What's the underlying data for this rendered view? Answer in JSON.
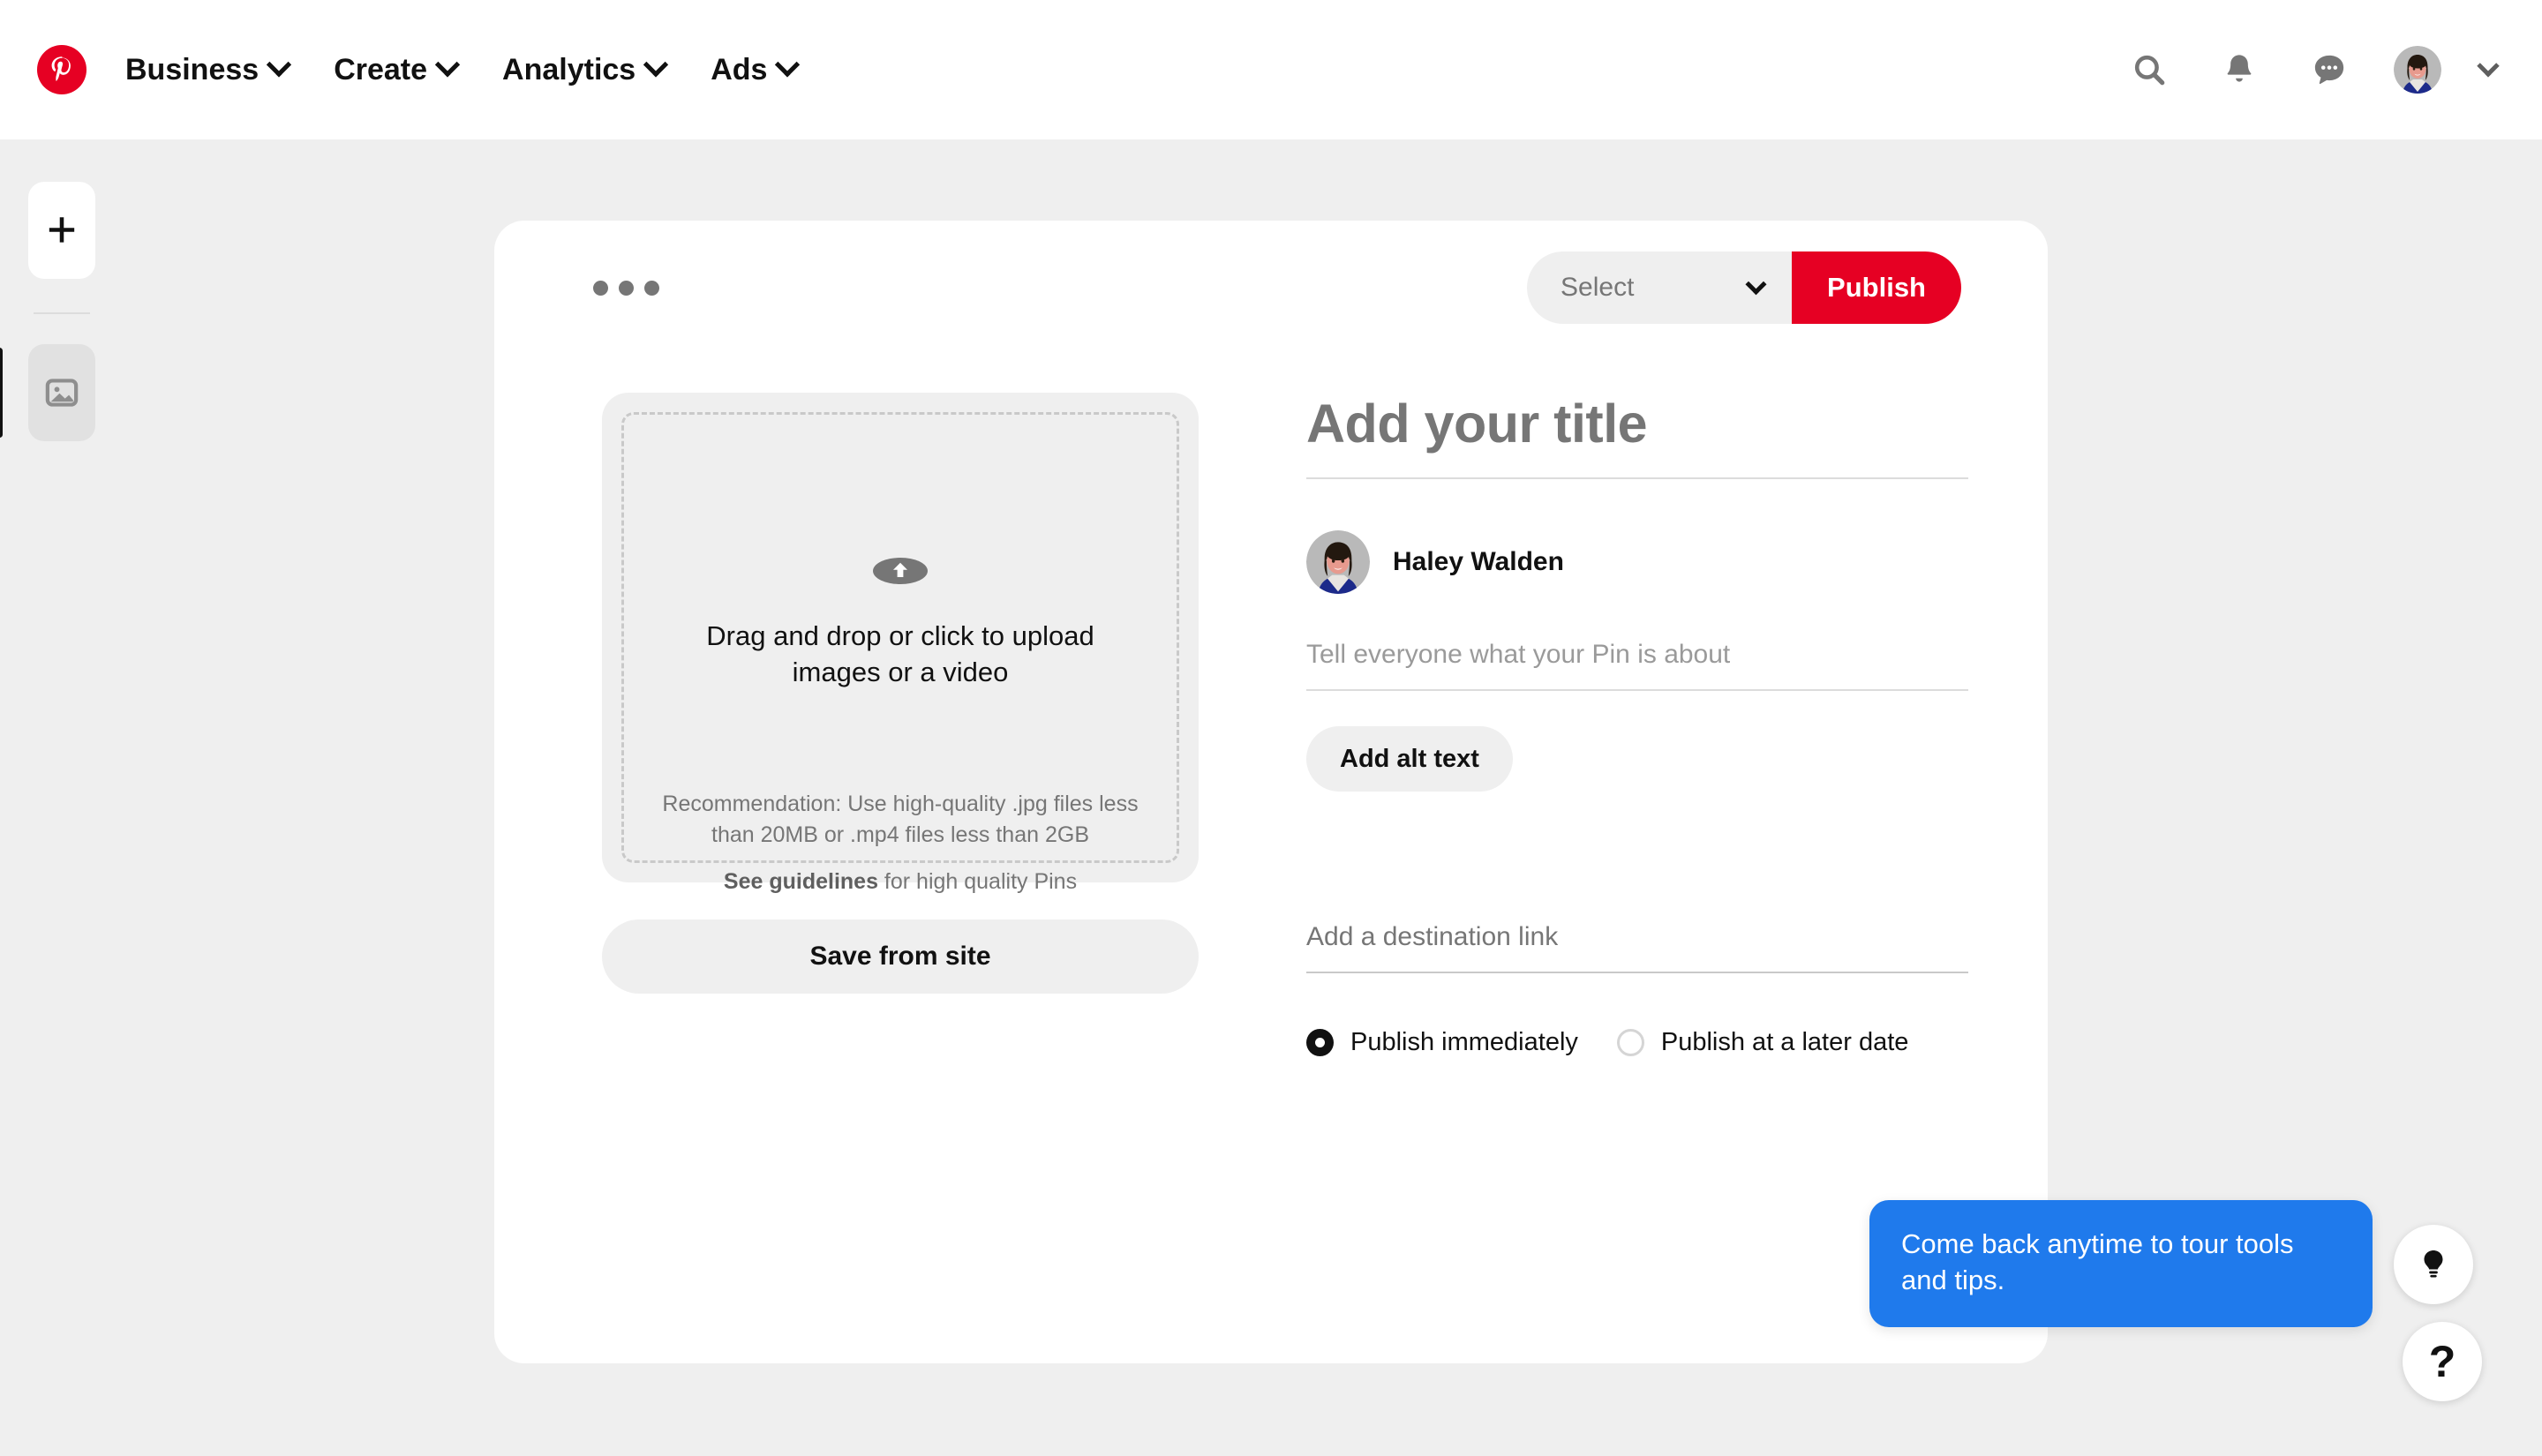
{
  "header": {
    "logo": "pinterest-logo",
    "nav": [
      {
        "label": "Business",
        "icon": "chevron-down-icon"
      },
      {
        "label": "Create",
        "icon": "chevron-down-icon"
      },
      {
        "label": "Analytics",
        "icon": "chevron-down-icon"
      },
      {
        "label": "Ads",
        "icon": "chevron-down-icon"
      }
    ],
    "actions": [
      {
        "name": "search-icon"
      },
      {
        "name": "notifications-bell-icon"
      },
      {
        "name": "messages-icon"
      }
    ],
    "account_chevron": "chevron-down-icon"
  },
  "rail": {
    "add_label": "+",
    "add_icon": "plus-icon",
    "thumb_icon": "image-placeholder-icon"
  },
  "card": {
    "overflow_menu": "more-options-icon",
    "select": {
      "value": "Select",
      "icon": "chevron-down-icon"
    },
    "publish_label": "Publish"
  },
  "upload": {
    "icon": "upload-arrow-icon",
    "headline": "Drag and drop or click to upload images or a video",
    "recommendation": "Recommendation: Use high-quality .jpg files less than 20MB or .mp4 files less than 2GB",
    "guidelines_link": "See guidelines",
    "guidelines_rest": " for high quality Pins",
    "save_from_site_label": "Save from site"
  },
  "fields": {
    "title_placeholder": "Add your title",
    "author_name": "Haley Walden",
    "description_placeholder": "Tell everyone what your Pin is about",
    "alt_text_label": "Add alt text",
    "link_placeholder": "Add a destination link",
    "schedule": [
      {
        "label": "Publish immediately",
        "selected": true
      },
      {
        "label": "Publish at a later date",
        "selected": false
      }
    ]
  },
  "tooltip": {
    "text": "Come back anytime to tour tools and tips."
  },
  "fabs": [
    {
      "name": "lightbulb-icon"
    },
    {
      "name": "help-icon",
      "label": "?"
    }
  ],
  "colors": {
    "brand_red": "#e60023",
    "tooltip_blue": "#1f7aec",
    "page_bg": "#efefef",
    "card_bg": "#ffffff"
  }
}
